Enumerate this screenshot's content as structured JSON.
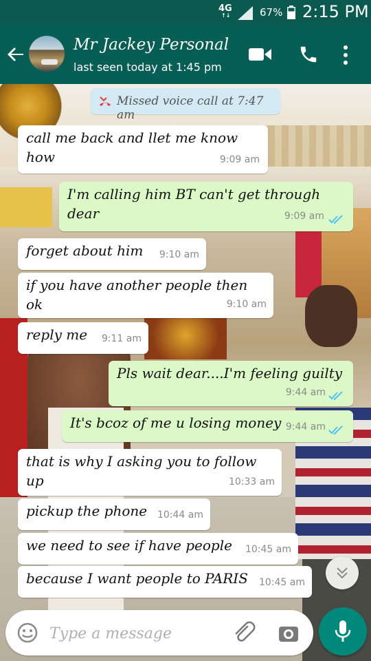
{
  "status_bar": {
    "network": "4G",
    "battery_percent": "67%",
    "time": "2:15 PM"
  },
  "header": {
    "contact_name": "Mr Jackey Personal",
    "last_seen": "last seen today at 1:45 pm",
    "icons": [
      "back-arrow-icon",
      "video-call-icon",
      "phone-call-icon",
      "more-options-icon"
    ]
  },
  "system_message": {
    "text": "Missed voice call at 7:47 am",
    "icon": "missed-call-icon"
  },
  "messages": [
    {
      "direction": "in",
      "text": "call me back and llet me know how",
      "time": "9:09 am"
    },
    {
      "direction": "out",
      "text": "I'm calling him BT can't get through dear",
      "time": "9:09 am",
      "status": "read"
    },
    {
      "direction": "in",
      "text": "forget about him",
      "time": "9:10 am"
    },
    {
      "direction": "in",
      "text": "if you have another people then ok",
      "time": "9:10 am"
    },
    {
      "direction": "in",
      "text": "reply me",
      "time": "9:11 am"
    },
    {
      "direction": "out",
      "text": "Pls wait dear....I'm feeling guilty",
      "time": "9:44 am",
      "status": "read"
    },
    {
      "direction": "out",
      "text": "It's bcoz of me u losing money",
      "time": "9:44 am",
      "status": "read"
    },
    {
      "direction": "in",
      "text": "that is why I asking you to follow up",
      "time": "10:33 am"
    },
    {
      "direction": "in",
      "text": "pickup the phone",
      "time": "10:44 am"
    },
    {
      "direction": "in",
      "text": "we need to see if have people",
      "time": "10:45 am"
    },
    {
      "direction": "in",
      "text": "because I want people to PARIS",
      "time": "10:45 am"
    }
  ],
  "composer": {
    "placeholder": "Type a message",
    "icons": [
      "emoji-icon",
      "attach-icon",
      "camera-icon",
      "mic-icon"
    ]
  },
  "colors": {
    "header": "#075e54",
    "status_bar": "#0a5a50",
    "outgoing_bubble": "#dcf8c6",
    "incoming_bubble": "#ffffff",
    "read_ticks": "#4fc3f7",
    "mic_button": "#00897b"
  }
}
